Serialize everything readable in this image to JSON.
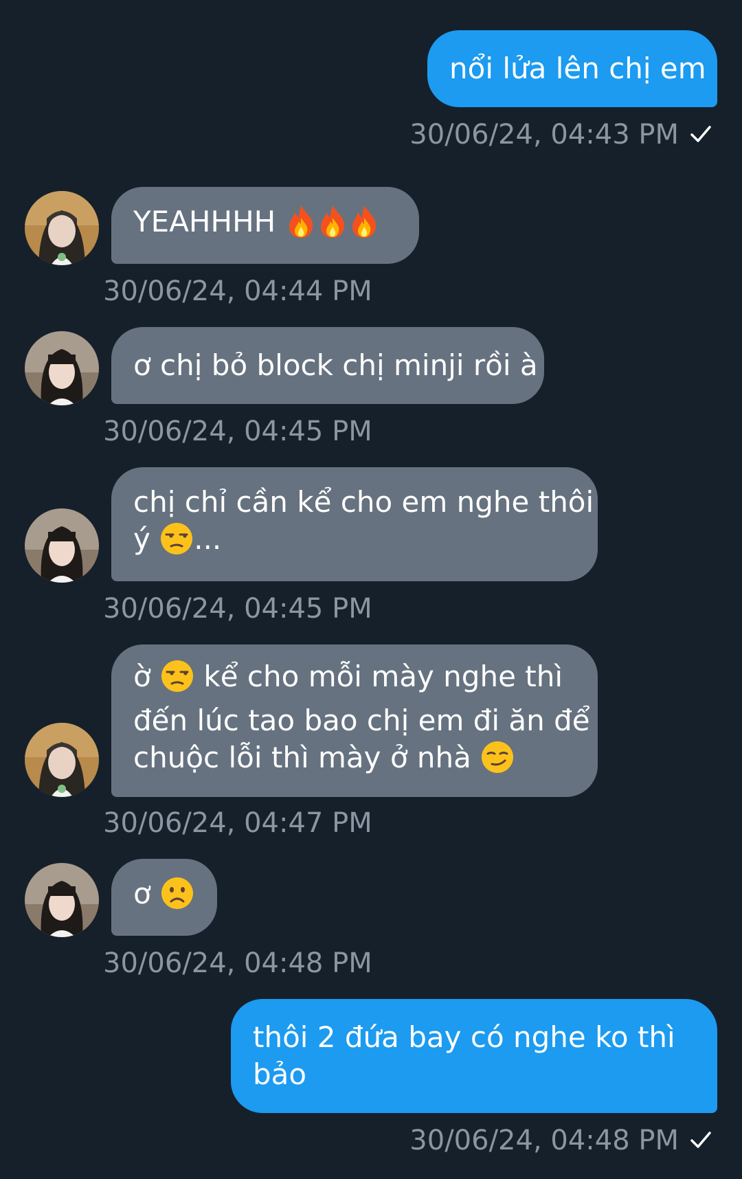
{
  "messages": [
    {
      "id": "m1",
      "direction": "out",
      "lines": [
        "nổi lửa lên chị em"
      ],
      "time": "30/06/24, 04:43 PM",
      "status": "sent"
    },
    {
      "id": "m2",
      "direction": "in",
      "sender": "avatar-a",
      "text": "YEAHHHH",
      "emoji": [
        "fire",
        "fire",
        "fire"
      ],
      "time": "30/06/24, 04:44 PM"
    },
    {
      "id": "m3",
      "direction": "in",
      "sender": "avatar-b",
      "lines": [
        "ơ chị bỏ block chị minji rồi à"
      ],
      "time": "30/06/24, 04:45 PM"
    },
    {
      "id": "m4",
      "direction": "in",
      "sender": "avatar-b",
      "lines": [
        "chị chỉ cần kể cho em nghe thôi",
        "ý",
        "..."
      ],
      "emoji": [
        "unamused-face"
      ],
      "time": "30/06/24, 04:45 PM"
    },
    {
      "id": "m5",
      "direction": "in",
      "sender": "avatar-a",
      "lines": [
        "ờ",
        "kể cho mỗi mày nghe thì",
        "đến lúc tao bao chị em đi ăn để",
        "chuộc lỗi thì mày ở nhà"
      ],
      "emoji": [
        "unamused-face",
        "smirking-face"
      ],
      "time": "30/06/24, 04:47 PM"
    },
    {
      "id": "m6",
      "direction": "in",
      "sender": "avatar-b",
      "lines": [
        "ơ"
      ],
      "emoji": [
        "frowning-face"
      ],
      "time": "30/06/24, 04:48 PM"
    },
    {
      "id": "m7",
      "direction": "out",
      "lines": [
        "thôi 2 đứa bay có nghe ko thì",
        "bảo"
      ],
      "time": "30/06/24, 04:48 PM",
      "status": "sent"
    }
  ],
  "colors": {
    "background": "#16202b",
    "outgoing_bubble": "#1c9bf0",
    "incoming_bubble": "#66727f",
    "timestamp": "#8b96a2"
  },
  "icons": [
    "checkmark-icon",
    "fire-emoji",
    "unamused-face-emoji",
    "smirking-face-emoji",
    "frowning-face-emoji"
  ]
}
